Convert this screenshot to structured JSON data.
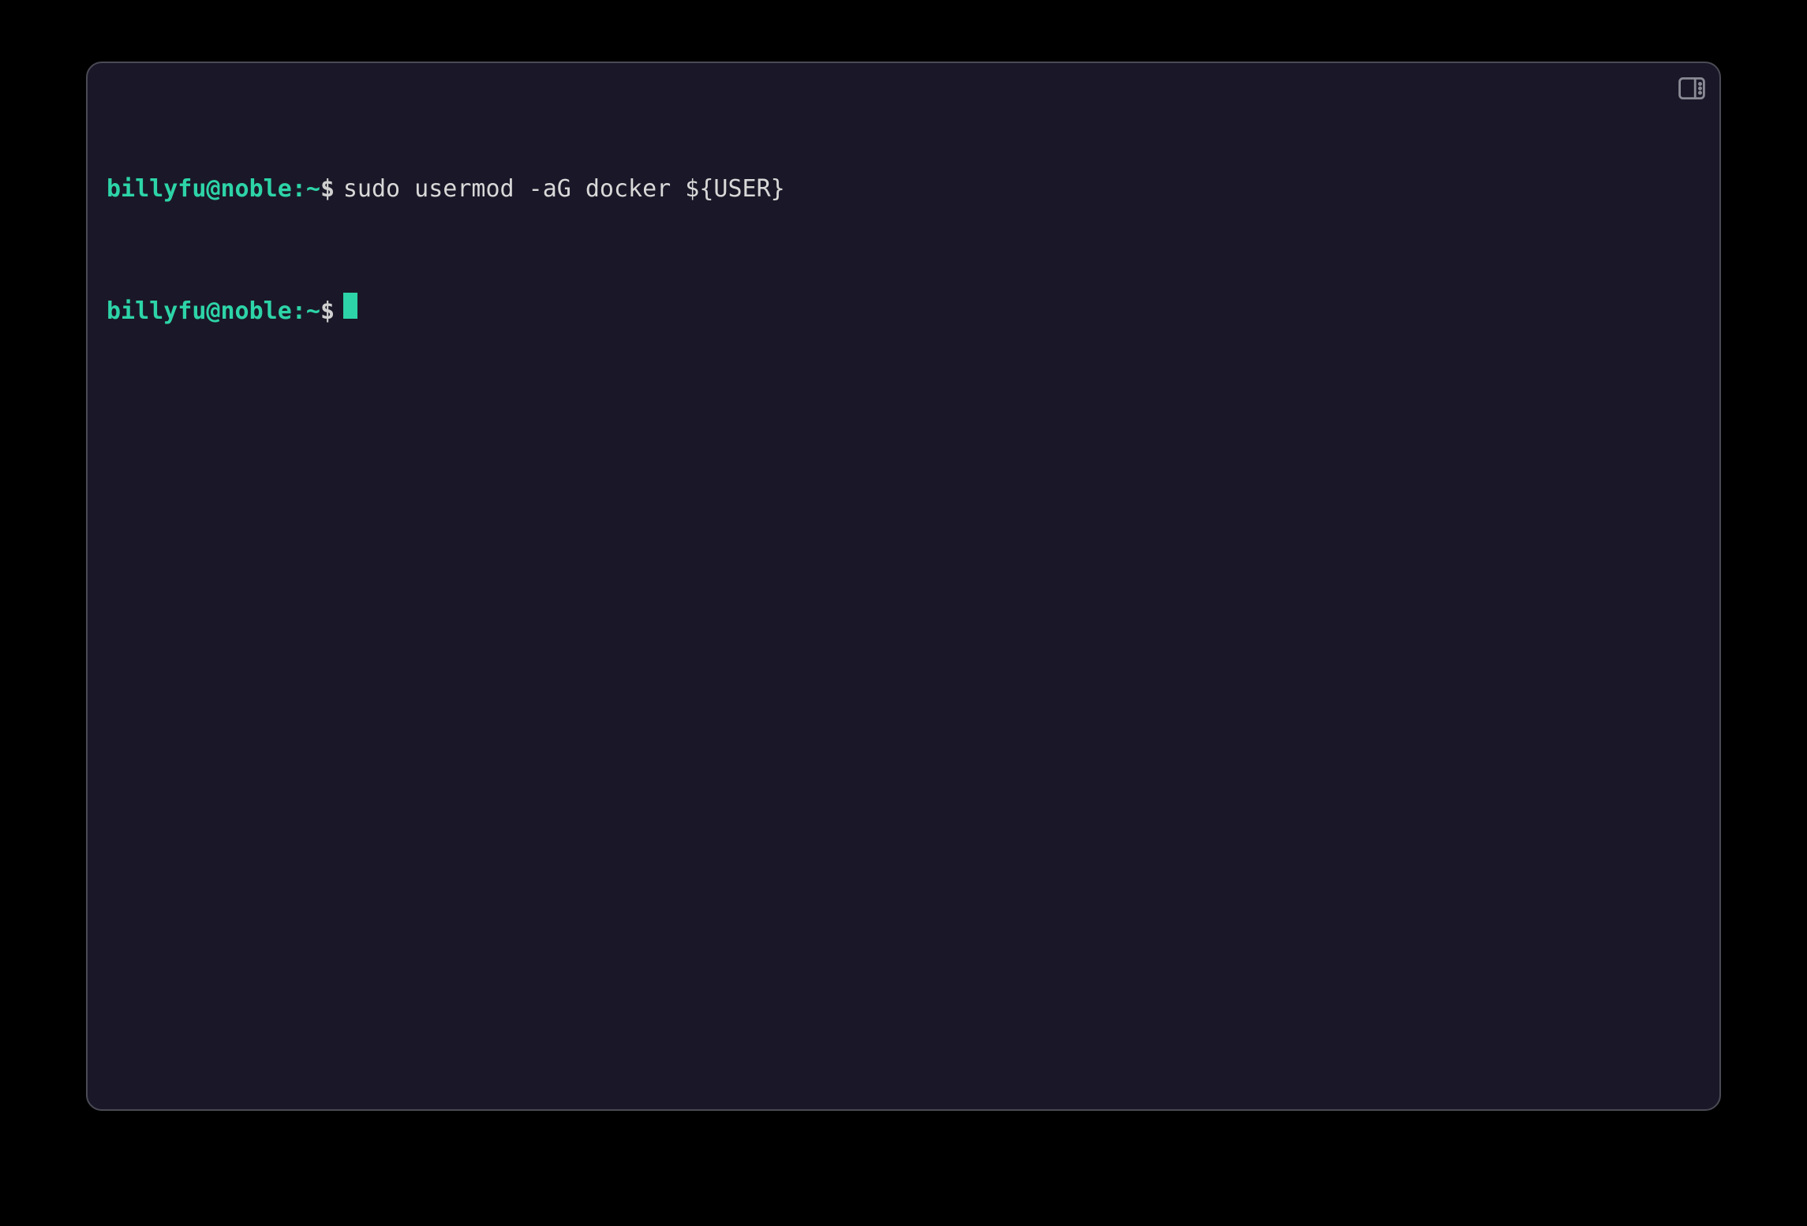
{
  "terminal": {
    "lines": [
      {
        "prompt": {
          "user_host": "billyfu@noble",
          "sep": ":",
          "path": "~",
          "symbol": "$"
        },
        "command": "sudo usermod -aG docker ${USER}"
      },
      {
        "prompt": {
          "user_host": "billyfu@noble",
          "sep": ":",
          "path": "~",
          "symbol": "$"
        },
        "command": ""
      }
    ],
    "colors": {
      "background": "#1a1828",
      "prompt": "#2dd4a7",
      "text": "#d8d8d8",
      "cursor": "#2dd4a7"
    }
  }
}
